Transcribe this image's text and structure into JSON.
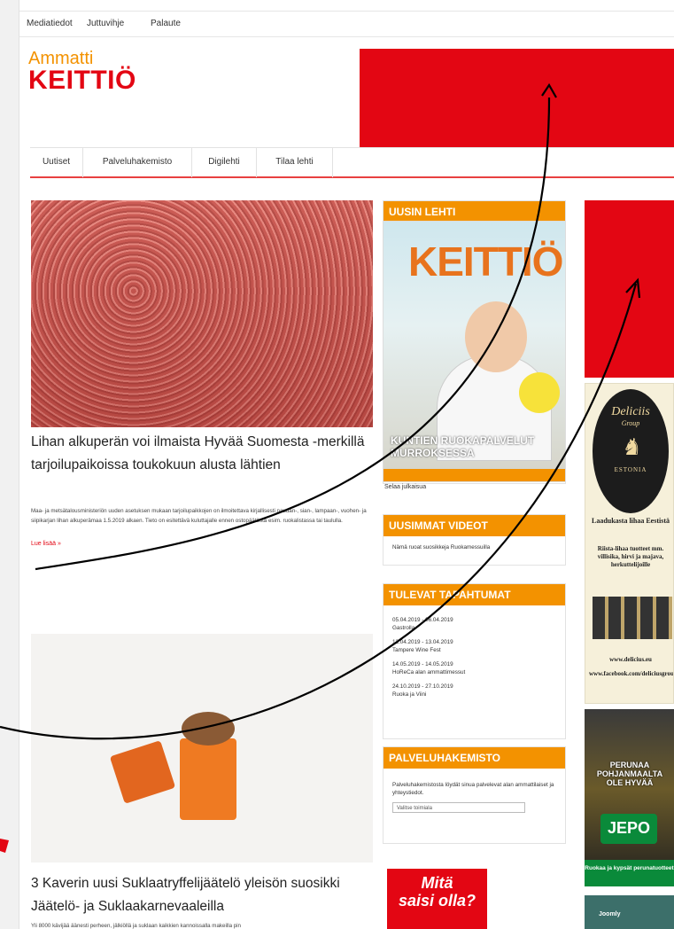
{
  "topbar": {
    "links": [
      "Mediatiedot",
      "Juttuvihje",
      "Palaute"
    ]
  },
  "logo": {
    "line1": "Ammatti",
    "line2": "KEITTIÖ"
  },
  "nav": {
    "items": [
      "Uutiset",
      "Palveluhakemisto",
      "Digilehti",
      "Tilaa lehti"
    ]
  },
  "articles": [
    {
      "title": "Lihan alkuperän voi ilmaista Hyvää Suomesta -merkillä tarjoilupaikoissa toukokuun alusta lähtien",
      "body": "Maa- ja metsätalousministeriön uuden asetuksen mukaan tarjoilupaikkojen on ilmoitettava kirjallisesti naudan-, sian-, lampaan-, vuohen- ja siipikarjan lihan alkuperämaa 1.5.2019 alkaen. Tieto on esitettävä kuluttajalle ennen ostopäätöstä esim. ruokalistassa tai taululla.",
      "read_more": "Lue lisää »"
    },
    {
      "title": "3 Kaverin uusi Suklaatryffelijäätelö yleisön suosikki Jäätelö- ja Suklaakarnevaaleilla",
      "body": "Yli 8000 kävijää äänesti perheen, jälkiöllä ja suklaan kaikkien kannoissalla makeilla pin"
    }
  ],
  "sidebar": {
    "latest_issue": {
      "heading": "UUSIN LEHTI",
      "cover_title": "KEITTIÖ",
      "cover_caption": "KUNTIEN RUOKAPALVELUT MURROKSESSA",
      "browse": "Selaa julkaisua"
    },
    "videos": {
      "heading": "UUSIMMAT VIDEOT",
      "text": "Nämä ruoat suosikkeja Ruokamessuilla"
    },
    "events": {
      "heading": "TULEVAT TAPAHTUMAT",
      "items": [
        {
          "date": "05.04.2019 - 06.04.2019",
          "name": "Gastrolla"
        },
        {
          "date": "12.04.2019 - 13.04.2019",
          "name": "Tampere Wine Fest"
        },
        {
          "date": "14.05.2019 - 14.05.2019",
          "name": "HoReCa alan ammattimessut"
        },
        {
          "date": "24.10.2019 - 27.10.2019",
          "name": "Ruoka ja Viini"
        }
      ]
    },
    "directory": {
      "heading": "PALVELUHAKEMISTO",
      "text": "Palveluhakemistosta löydät sinua palvelevat alan ammattilaiset ja yhteystiedot.",
      "select_value": "Valitse toimiala"
    },
    "promo": {
      "line1": "Mitä",
      "line2": "saisi olla?"
    }
  },
  "ads": {
    "delicius": {
      "brand": "Deliciis",
      "sub": "Group",
      "country": "ESTONIA",
      "headline": "Laadukasta lihaa Eestistä",
      "desc": "Riista-lihaa tuotteet mm. villisika, hirvi ja majava, herkuttelijoille",
      "web": "www.delicius.eu",
      "fb": "www.facebook.com/deliciusgroup"
    },
    "jepo": {
      "headline": "PERUNAA POHJANMAALTA OLE HYVÄÄ",
      "logo": "JEPO",
      "tagline": "Ruokaa ja kypsät perunatuotteet"
    },
    "joomly": {
      "name": "Joomly"
    }
  },
  "colors": {
    "brand_orange": "#f39200",
    "brand_red": "#e30613",
    "annotation": "#000000"
  }
}
